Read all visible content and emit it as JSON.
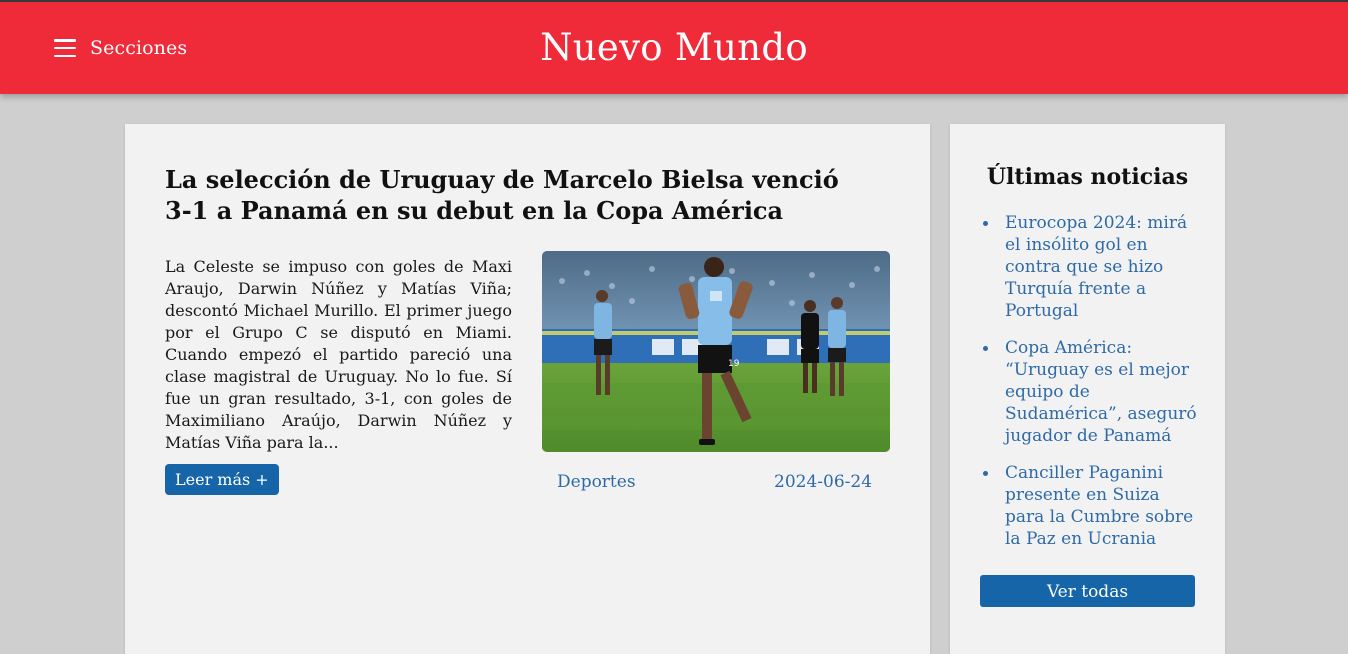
{
  "header": {
    "menu_label": "Secciones",
    "site_title": "Nuevo Mundo",
    "accent_color": "#ef2b39"
  },
  "article": {
    "title": "La selección de Uruguay de Marcelo Bielsa venció 3-1 a Panamá en su debut en la Copa América",
    "excerpt": "La Celeste se impuso con goles de Maxi Araujo, Darwin Núñez y Matías Viña; descontó Michael Murillo. El primer juego por el Grupo C se disputó en Miami. Cuando empezó el partido pareció una clase magistral de Uruguay. No lo fue. Sí fue un gran resultado, 3-1, con goles de Maximiliano Araújo, Darwin Núñez y Matías Viña para la...",
    "read_more_label": "Leer más +",
    "category": "Deportes",
    "date": "2024-06-24",
    "image_icon": "soccer-player-celebration-photo"
  },
  "sidebar": {
    "title": "Últimas noticias",
    "items": [
      {
        "label": "Eurocopa 2024: mirá el insólito gol en contra que se hizo Turquía frente a Portugal"
      },
      {
        "label": "Copa América: “Uruguay es el mejor equipo de Sudamérica”, aseguró jugador de Panamá"
      },
      {
        "label": "Canciller Paganini presente en Suiza para la Cumbre sobre la Paz en Ucrania"
      }
    ],
    "see_all_label": "Ver todas",
    "link_color": "#2e6aa8",
    "button_color": "#1565a8"
  }
}
